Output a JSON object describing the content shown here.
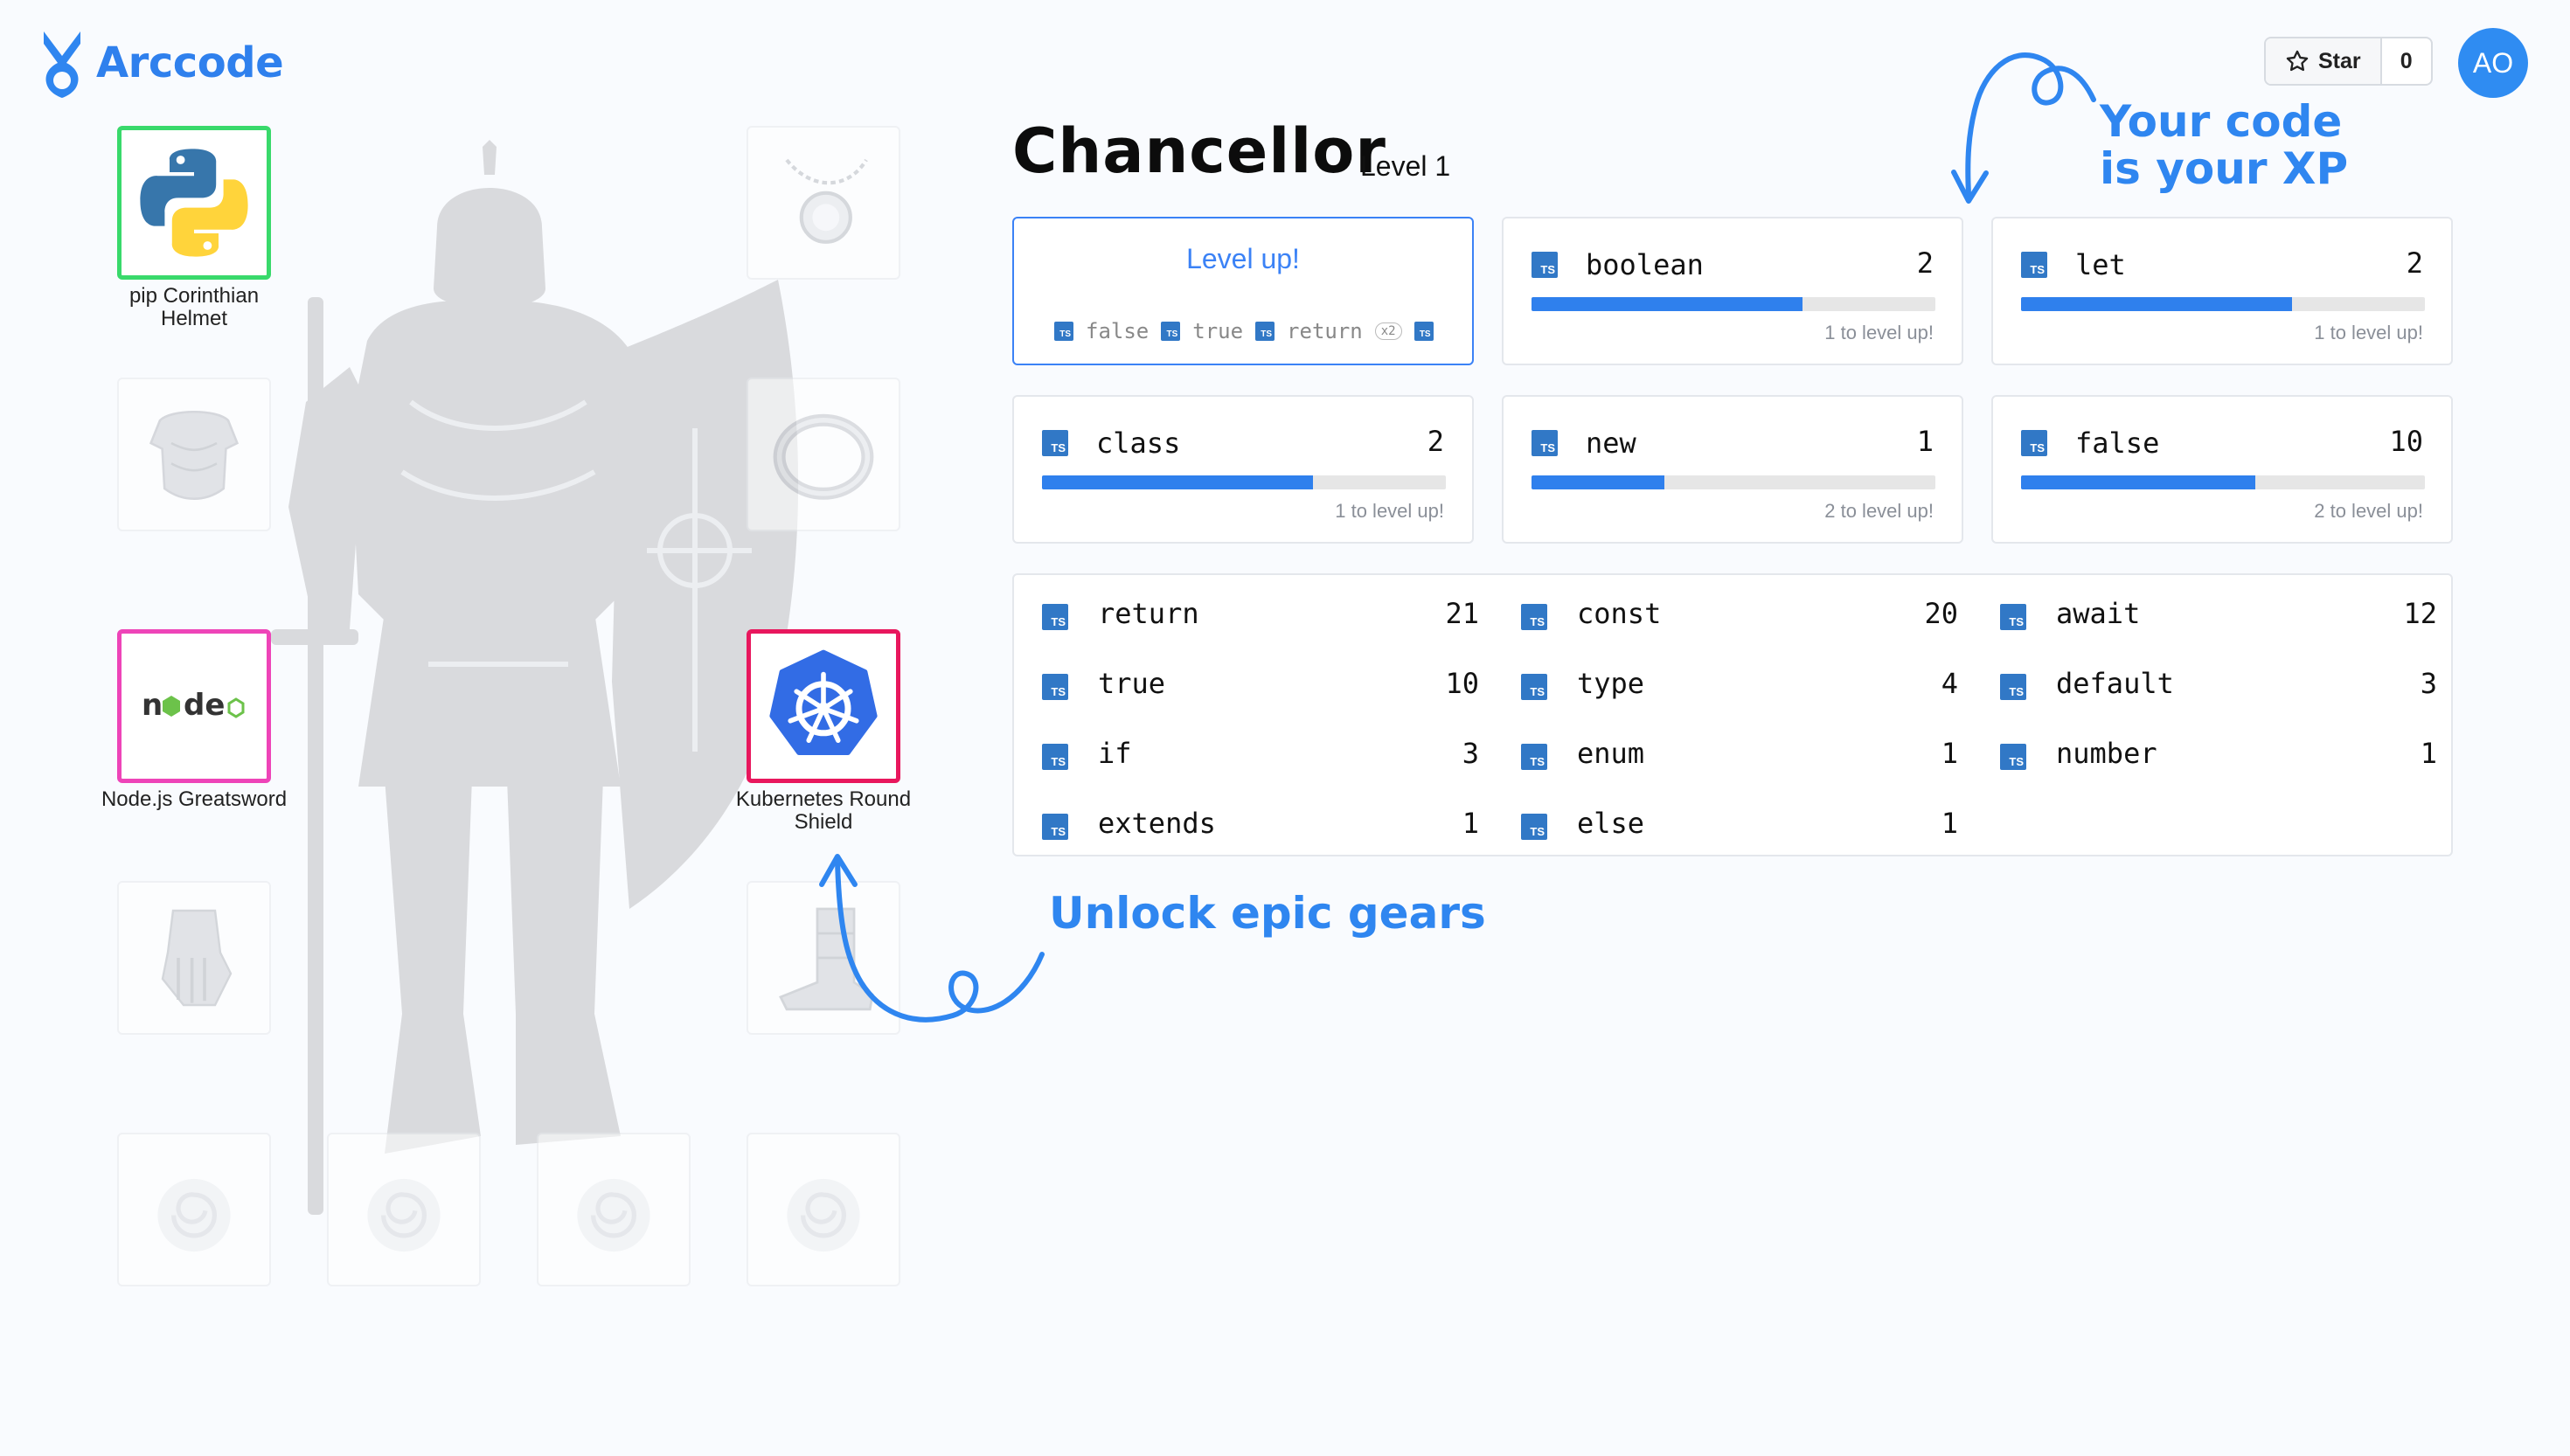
{
  "app": {
    "name": "Arccode"
  },
  "header": {
    "star_label": "Star",
    "star_count": "0",
    "avatar_initials": "AO"
  },
  "character": {
    "title": "Chancellor",
    "level_label": "Level 1"
  },
  "gear": {
    "top_left": {
      "label": "pip Corinthian Helmet"
    },
    "mid_left": {
      "label": "Node.js Greatsword",
      "logo_text": "node"
    },
    "mid_right": {
      "label": "Kubernetes Round Shield"
    }
  },
  "level_up": {
    "title": "Level up!",
    "ticker": [
      {
        "kw": "false",
        "mult": ""
      },
      {
        "kw": "true",
        "mult": ""
      },
      {
        "kw": "return",
        "mult": "x2"
      }
    ]
  },
  "progress_cards": [
    {
      "keyword": "boolean",
      "count": "2",
      "progress": 0.67,
      "hint": "1 to level up!"
    },
    {
      "keyword": "let",
      "count": "2",
      "progress": 0.67,
      "hint": "1 to level up!"
    },
    {
      "keyword": "class",
      "count": "2",
      "progress": 0.67,
      "hint": "1 to level up!"
    },
    {
      "keyword": "new",
      "count": "1",
      "progress": 0.33,
      "hint": "2 to level up!"
    },
    {
      "keyword": "false",
      "count": "10",
      "progress": 0.58,
      "hint": "2 to level up!"
    }
  ],
  "keyword_table": [
    {
      "keyword": "return",
      "count": "21"
    },
    {
      "keyword": "const",
      "count": "20"
    },
    {
      "keyword": "await",
      "count": "12"
    },
    {
      "keyword": "true",
      "count": "10"
    },
    {
      "keyword": "type",
      "count": "4"
    },
    {
      "keyword": "default",
      "count": "3"
    },
    {
      "keyword": "if",
      "count": "3"
    },
    {
      "keyword": "enum",
      "count": "1"
    },
    {
      "keyword": "number",
      "count": "1"
    },
    {
      "keyword": "extends",
      "count": "1"
    },
    {
      "keyword": "else",
      "count": "1"
    }
  ],
  "ts_badge": "TS",
  "callouts": {
    "xp_line1": "Your code",
    "xp_line2": "is your XP",
    "gears": "Unlock epic gears"
  },
  "colors": {
    "accent": "#2f80ed",
    "callout": "#2f86f0",
    "ts_blue": "#3178c6"
  },
  "icons": [
    "arccode-logo-icon",
    "star-icon",
    "python-icon",
    "nodejs-logo-icon",
    "kubernetes-icon",
    "ts-icon"
  ]
}
